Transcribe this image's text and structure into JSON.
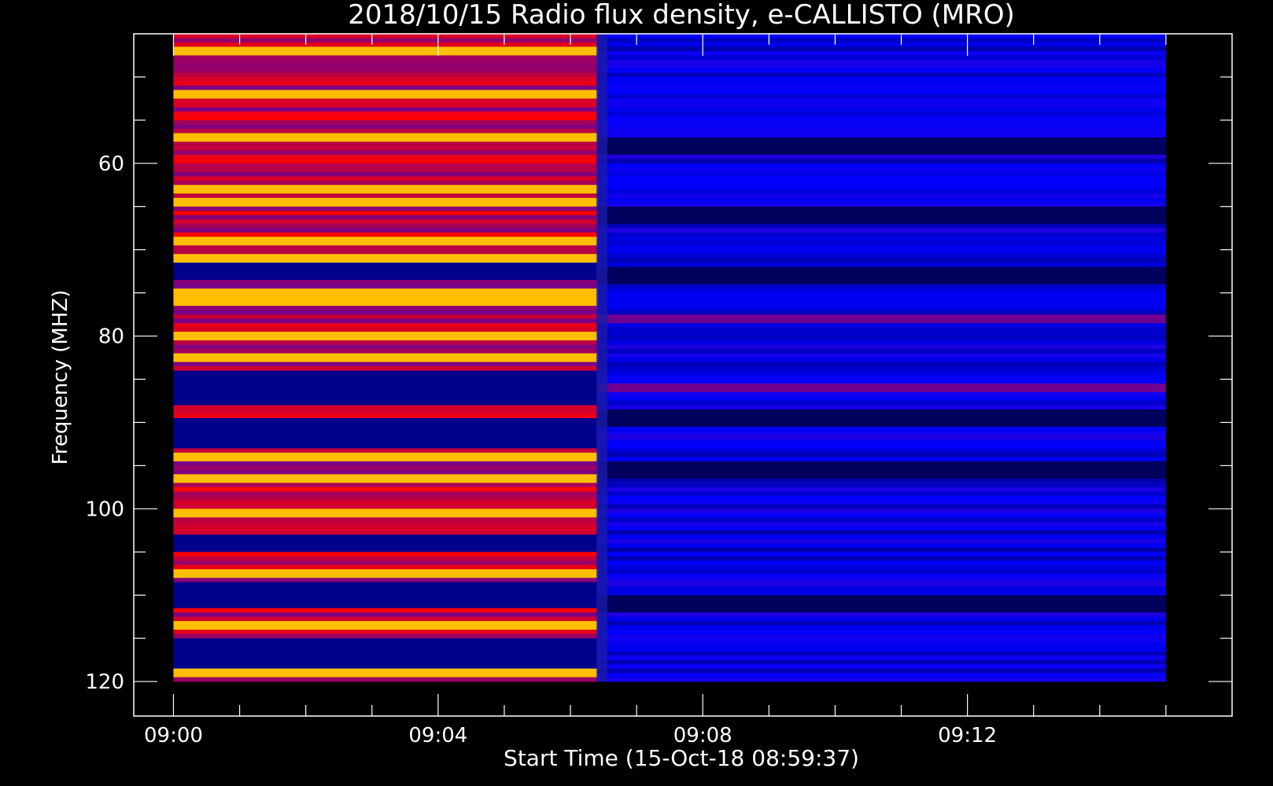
{
  "chart_data": {
    "type": "heatmap",
    "title": "2018/10/15  Radio flux density, e-CALLISTO (MRO)",
    "xlabel": "Start Time (15-Oct-18 08:59:37)",
    "ylabel": "Frequency (MHZ)",
    "x_start": "09:00",
    "x_end": "09:15",
    "xlim_minutes_after_0900": [
      -0.6,
      16.0
    ],
    "ylim_mhz": [
      124,
      45
    ],
    "y_reversed": true,
    "x_ticks": [
      "09:00",
      "09:04",
      "09:08",
      "09:12"
    ],
    "y_ticks": [
      60,
      80,
      100,
      120
    ],
    "data_extent": {
      "time": [
        "09:00",
        "09:15"
      ],
      "frequency_mhz": [
        45,
        120
      ]
    },
    "colormap": [
      "#000000",
      "#0000ff",
      "#ff0000",
      "#ffff00"
    ],
    "regions": [
      {
        "time": [
          "09:00",
          "09:06:25"
        ],
        "description_level": "high",
        "bright_bands_mhz": [
          47,
          52,
          57,
          63,
          64.5,
          69,
          71,
          75,
          76,
          80,
          82.5,
          94,
          96.5,
          100.5,
          107.5,
          113.5,
          119
        ],
        "quiet_bands_mhz": [
          72.5,
          85,
          87,
          90.5,
          92,
          104,
          109.5,
          110.5,
          116,
          117.5
        ]
      },
      {
        "time": [
          "09:06:25",
          "09:15"
        ],
        "description_level": "low",
        "bright_bands_mhz": [
          78,
          86
        ],
        "quiet_bands_mhz": [
          58,
          66,
          73,
          89.5,
          95.5,
          111
        ]
      }
    ]
  }
}
